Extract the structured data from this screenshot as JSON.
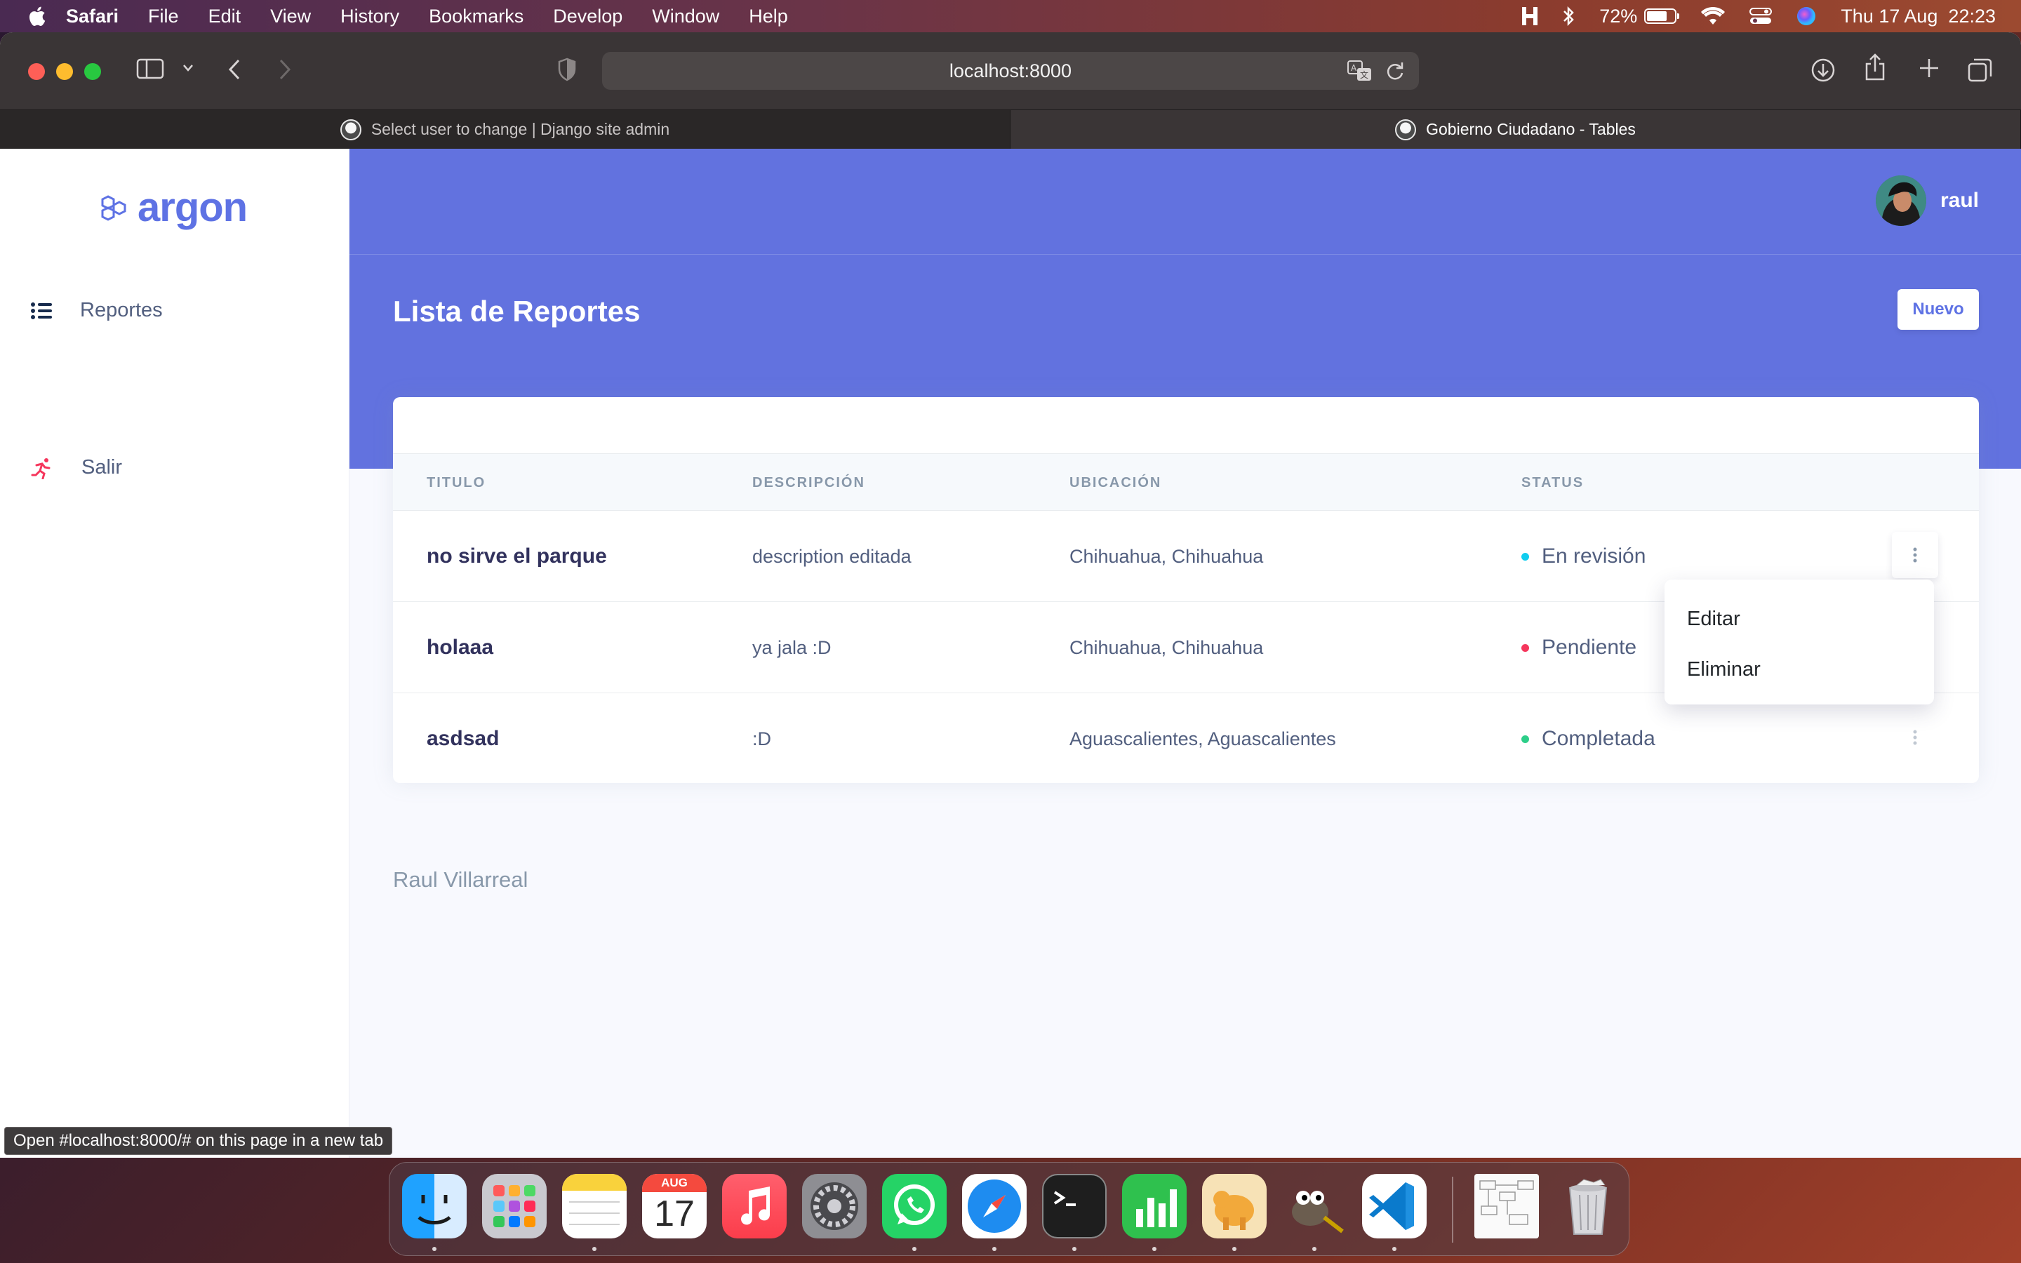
{
  "menubar": {
    "app_name": "Safari",
    "items": [
      "File",
      "Edit",
      "View",
      "History",
      "Bookmarks",
      "Develop",
      "Window",
      "Help"
    ],
    "battery_percent": "72%",
    "battery_level": 0.72,
    "datetime": "Thu 17 Aug  22:23"
  },
  "browser": {
    "url": "localhost:8000",
    "tabs": [
      {
        "title": "Select user to change | Django site admin",
        "active": false
      },
      {
        "title": "Gobierno Ciudadano - Tables",
        "active": true
      }
    ],
    "status_link": "Open #localhost:8000/# on this page in a new tab"
  },
  "sidebar": {
    "brand": "argon",
    "items": [
      {
        "label": "Reportes",
        "icon": "list-icon"
      },
      {
        "label": "Salir",
        "icon": "running-person-icon"
      }
    ]
  },
  "header": {
    "user_name": "raul",
    "page_title": "Lista de Reportes",
    "new_button": "Nuevo"
  },
  "table": {
    "columns": [
      "TITULO",
      "DESCRIPCIÓN",
      "UBICACIÓN",
      "STATUS"
    ],
    "rows": [
      {
        "titulo": "no sirve el parque",
        "descripcion": "description editada",
        "ubicacion": "Chihuahua, Chihuahua",
        "status": "En revisión",
        "status_color": "#11cdef"
      },
      {
        "titulo": "holaaa",
        "descripcion": "ya jala :D",
        "ubicacion": "Chihuahua, Chihuahua",
        "status": "Pendiente",
        "status_color": "#f5365c"
      },
      {
        "titulo": "asdsad",
        "descripcion": ":D",
        "ubicacion": "Aguascalientes, Aguascalientes",
        "status": "Completada",
        "status_color": "#2dce89"
      }
    ]
  },
  "dropdown": {
    "items": [
      "Editar",
      "Eliminar"
    ]
  },
  "footer": {
    "author": "Raul Villarreal"
  },
  "dock": {
    "calendar_month": "AUG",
    "calendar_day": "17",
    "apps": [
      "finder-icon",
      "launchpad-icon",
      "notes-icon",
      "calendar-icon",
      "music-icon",
      "system-settings-icon",
      "whatsapp-icon",
      "safari-icon",
      "terminal-icon",
      "numbers-icon",
      "tableplus-icon",
      "gimp-icon",
      "vscode-icon",
      "document-preview-icon",
      "trash-icon"
    ]
  },
  "colors": {
    "accent": "#5e72e4",
    "header_bg": "#6272df"
  }
}
